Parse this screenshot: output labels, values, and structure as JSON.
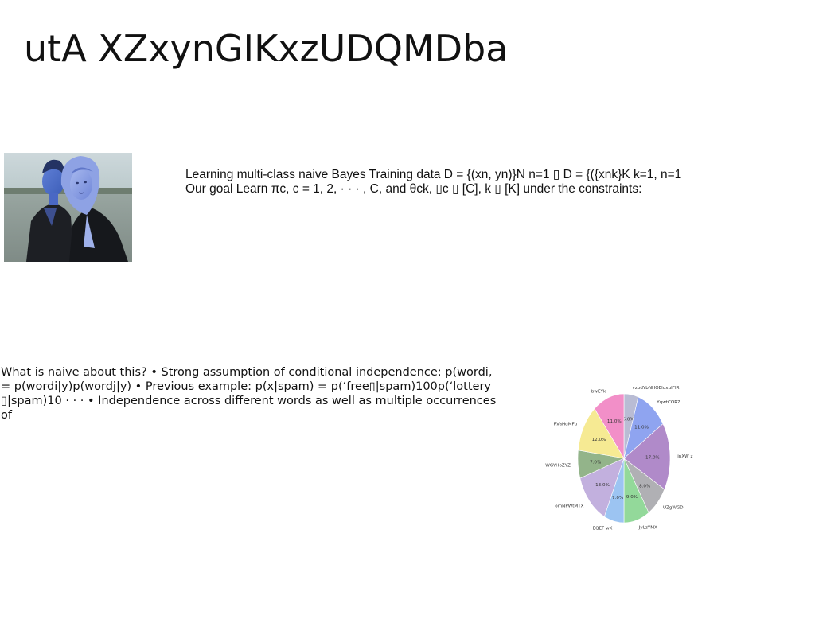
{
  "slide": {
    "title": "utA XZxynGIKxzUDQMDba",
    "paragraph_1": "Learning multi-class naive Bayes Training data D = {(xn, yn)}N n=1 ▯ D = {({xnk}K k=1, n=1 Our goal Learn πc, c = 1, 2, · · · , C, and θck, ▯c ▯ [C], k ▯ [K] under the constraints:",
    "paragraph_2": "What is naive about this? • Strong assumption of conditional independence: p(wordi, = p(wordi|y)p(wordj|y) • Previous example: p(x|spam) = p(‘free▯|spam)100p(‘lottery ▯|spam)10 · · · • Independence across different words as well as multiple occurrences of"
  },
  "photo": {
    "description_icon": "photo-two-people-icon"
  },
  "chart_data": {
    "type": "pie",
    "title": "",
    "start_angle_deg": 90,
    "direction": "clockwise",
    "slices": [
      {
        "label": "vzpdYbNHOElqxuIFIR",
        "value": 5.0,
        "pct_label": "5.0%",
        "color": "#b9bcd4"
      },
      {
        "label": "YqwtCORZ",
        "value": 11.0,
        "pct_label": "11.0%",
        "color": "#8fa4f0"
      },
      {
        "label": "inXW z",
        "value": 17.0,
        "pct_label": "17.0%",
        "color": "#b08ac9"
      },
      {
        "label": "UZgWGDi",
        "value": 8.0,
        "pct_label": "8.0%",
        "color": "#b0b0b4"
      },
      {
        "label": "JyLzYMX",
        "value": 9.0,
        "pct_label": "9.0%",
        "color": "#93d99a"
      },
      {
        "label": "EQEF wK",
        "value": 7.0,
        "pct_label": "7.0%",
        "color": "#9cc4f2"
      },
      {
        "label": "omNPWtMTX",
        "value": 13.0,
        "pct_label": "13.0%",
        "color": "#c2b0de"
      },
      {
        "label": "WGYHoZYZ",
        "value": 7.0,
        "pct_label": "7.0%",
        "color": "#93b48a"
      },
      {
        "label": "RVaHgMFu",
        "value": 12.0,
        "pct_label": "12.0%",
        "color": "#f6ea93"
      },
      {
        "label": "bwEYk",
        "value": 11.0,
        "pct_label": "11.0%",
        "color": "#f28fc8"
      }
    ]
  }
}
